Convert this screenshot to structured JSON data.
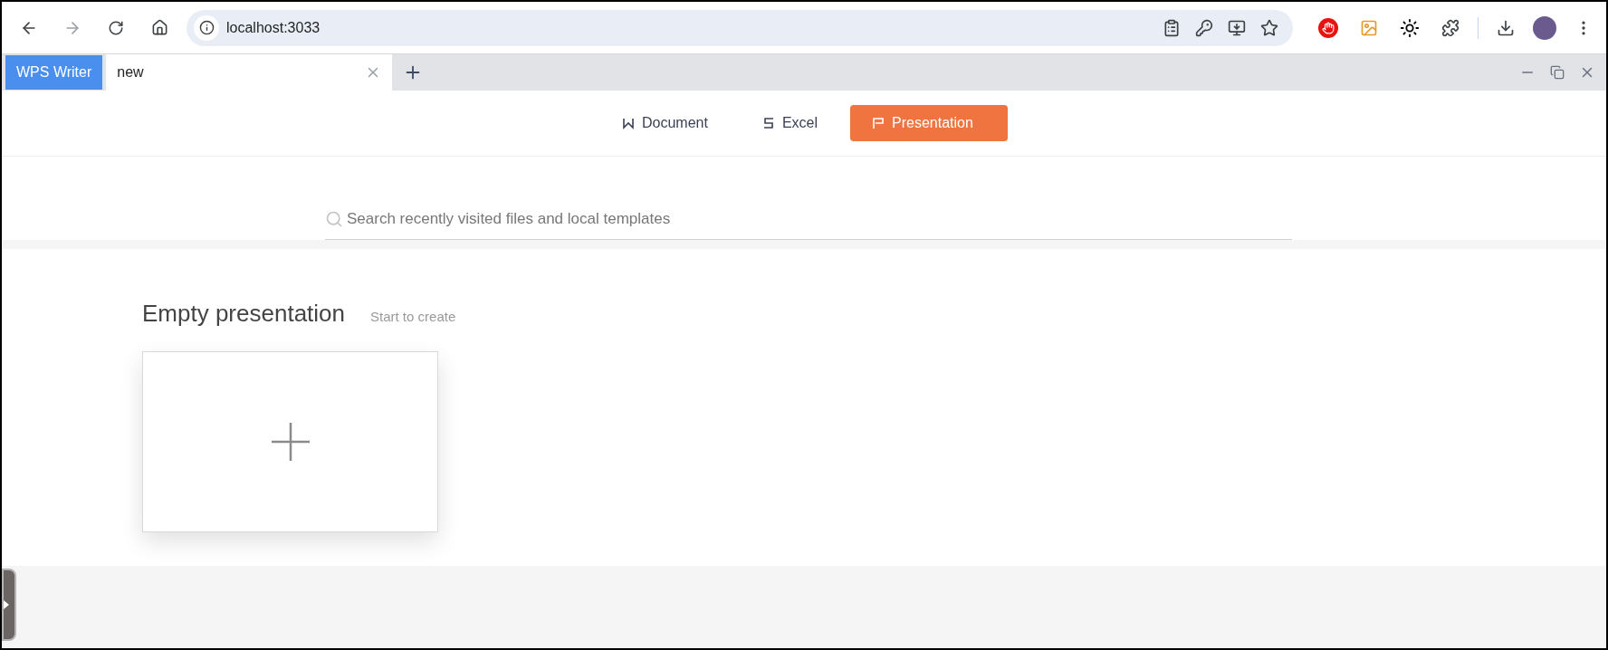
{
  "browser": {
    "url": "localhost:3033"
  },
  "tab_bar": {
    "app_label": "WPS Writer",
    "tabs": [
      {
        "label": "new",
        "selected": true
      }
    ]
  },
  "modes": [
    {
      "label": "Document",
      "kind": "document",
      "selected": false
    },
    {
      "label": "Excel",
      "kind": "excel",
      "selected": false
    },
    {
      "label": "Presentation",
      "kind": "presentation",
      "selected": true
    }
  ],
  "search": {
    "placeholder": "Search recently visited files and local templates"
  },
  "section": {
    "title": "Empty presentation",
    "subtitle": "Start to create"
  }
}
